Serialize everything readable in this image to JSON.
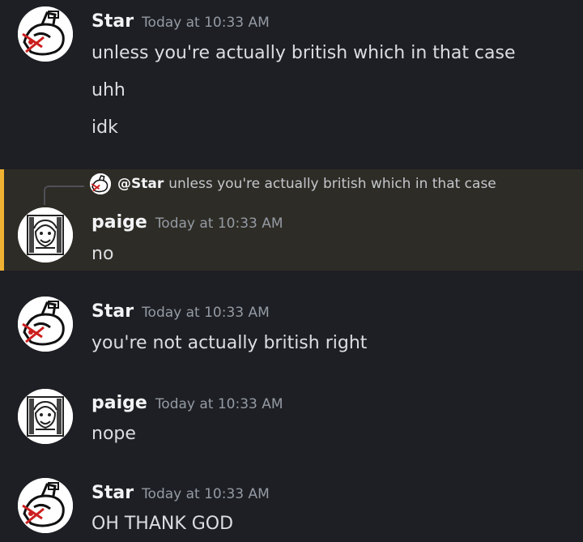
{
  "messages": [
    {
      "author": "Star",
      "time": "Today at 10:33 AM",
      "lines": [
        "unless you're actually british which in that case",
        "uhh",
        "idk"
      ]
    },
    {
      "reply_to": {
        "author": "@Star",
        "text": "unless you're actually british which in that case"
      },
      "author": "paige",
      "time": "Today at 10:33 AM",
      "lines": [
        "no"
      ]
    },
    {
      "author": "Star",
      "time": "Today at 10:33 AM",
      "lines": [
        "you're not actually british right"
      ]
    },
    {
      "author": "paige",
      "time": "Today at 10:33 AM",
      "lines": [
        "nope"
      ]
    },
    {
      "author": "Star",
      "time": "Today at 10:33 AM",
      "lines": [
        "OH THANK GOD"
      ]
    }
  ],
  "colors": {
    "background": "#1e1f24",
    "mention_highlight": "#2e2c26",
    "mention_bar": "#f0b232",
    "username": "#f2f3f5",
    "timestamp": "#949ba4",
    "message_text": "#dbdee1"
  },
  "icons": {
    "star_avatar": "star-avatar-icon",
    "paige_avatar": "paige-avatar-icon"
  }
}
